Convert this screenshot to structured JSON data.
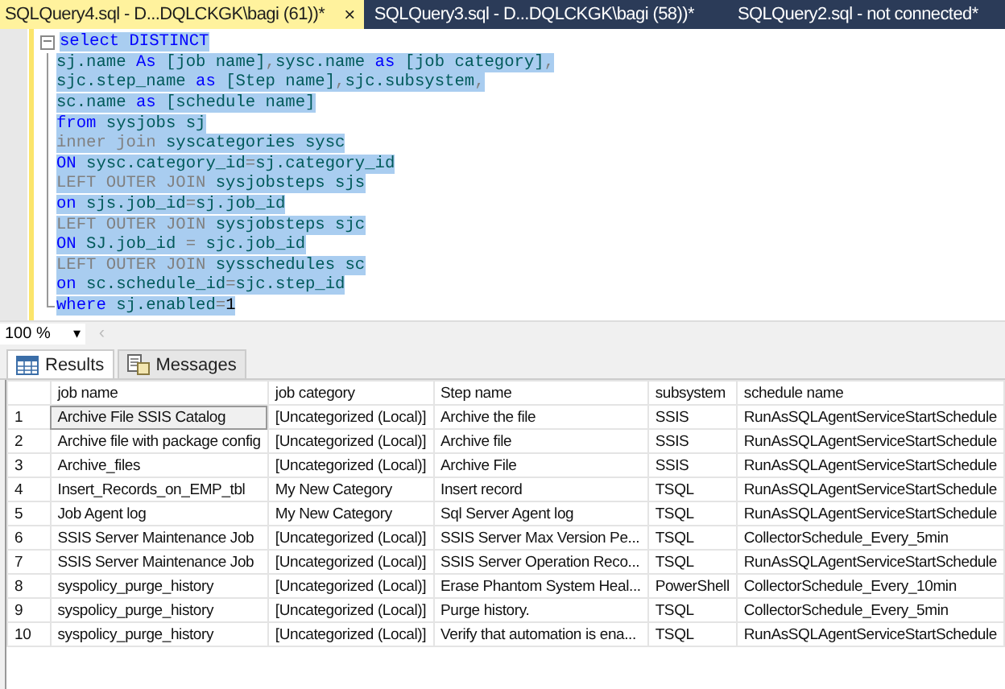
{
  "tabs": [
    {
      "label": "SQLQuery4.sql - D...DQLCKGK\\bagi (61))*",
      "selected": true,
      "close": "×"
    },
    {
      "label": "SQLQuery3.sql - D...DQLCKGK\\bagi (58))*",
      "selected": false
    },
    {
      "label": "SQLQuery2.sql - not connected*",
      "selected": false
    }
  ],
  "editor": {
    "collapse": "−",
    "lines": [
      [
        {
          "text": "select DISTINCT",
          "kind": "kw"
        }
      ],
      [
        {
          "text": "sj.name ",
          "kind": "id"
        },
        {
          "text": "As ",
          "kind": "kw"
        },
        {
          "text": "[job name]",
          "kind": "id"
        },
        {
          "text": ",",
          "kind": "op"
        },
        {
          "text": "sysc.name ",
          "kind": "id"
        },
        {
          "text": "as ",
          "kind": "kw"
        },
        {
          "text": "[job category]",
          "kind": "id"
        },
        {
          "text": ",",
          "kind": "op"
        }
      ],
      [
        {
          "text": "sjc.step_name ",
          "kind": "id"
        },
        {
          "text": "as ",
          "kind": "kw"
        },
        {
          "text": "[Step name]",
          "kind": "id"
        },
        {
          "text": ",",
          "kind": "op"
        },
        {
          "text": "sjc.subsystem",
          "kind": "id"
        },
        {
          "text": ",",
          "kind": "op"
        }
      ],
      [
        {
          "text": "sc.name ",
          "kind": "id"
        },
        {
          "text": "as ",
          "kind": "kw"
        },
        {
          "text": "[schedule name]",
          "kind": "id"
        }
      ],
      [
        {
          "text": "from ",
          "kind": "kw"
        },
        {
          "text": "sysjobs sj",
          "kind": "id"
        }
      ],
      [
        {
          "text": "inner join ",
          "kind": "op"
        },
        {
          "text": "syscategories sysc",
          "kind": "id"
        }
      ],
      [
        {
          "text": "ON ",
          "kind": "kw"
        },
        {
          "text": "sysc.category_id",
          "kind": "id"
        },
        {
          "text": "=",
          "kind": "op"
        },
        {
          "text": "sj.category_id",
          "kind": "id"
        }
      ],
      [
        {
          "text": "LEFT OUTER JOIN ",
          "kind": "op"
        },
        {
          "text": "sysjobsteps sjs",
          "kind": "id"
        }
      ],
      [
        {
          "text": "on ",
          "kind": "kw"
        },
        {
          "text": "sjs.job_id",
          "kind": "id"
        },
        {
          "text": "=",
          "kind": "op"
        },
        {
          "text": "sj.job_id",
          "kind": "id"
        }
      ],
      [
        {
          "text": "LEFT OUTER JOIN ",
          "kind": "op"
        },
        {
          "text": "sysjobsteps sjc",
          "kind": "id"
        }
      ],
      [
        {
          "text": "ON ",
          "kind": "kw"
        },
        {
          "text": "SJ.job_id ",
          "kind": "id"
        },
        {
          "text": "=",
          "kind": "op"
        },
        {
          "text": " sjc.job_id",
          "kind": "id"
        }
      ],
      [
        {
          "text": "LEFT OUTER JOIN ",
          "kind": "op"
        },
        {
          "text": "sysschedules sc",
          "kind": "id"
        }
      ],
      [
        {
          "text": "on ",
          "kind": "kw"
        },
        {
          "text": "sc.schedule_id",
          "kind": "id"
        },
        {
          "text": "=",
          "kind": "op"
        },
        {
          "text": "sjc.step_id",
          "kind": "id"
        }
      ],
      [
        {
          "text": "where ",
          "kind": "kw"
        },
        {
          "text": "sj.enabled",
          "kind": "id"
        },
        {
          "text": "=",
          "kind": "op"
        },
        {
          "text": "1",
          "kind": "num"
        }
      ]
    ]
  },
  "zoom": {
    "value": "100 %",
    "caret": "▾",
    "scroll": "‹"
  },
  "result_tabs": [
    {
      "label": "Results",
      "selected": true,
      "kind": "grid"
    },
    {
      "label": "Messages",
      "selected": false,
      "kind": "messages"
    }
  ],
  "table": {
    "columns": [
      "job name",
      "job category",
      "Step name",
      "subsystem",
      "schedule name"
    ],
    "rows": [
      {
        "number": "1",
        "focused": true,
        "cells": [
          "Archive File SSIS Catalog",
          "[Uncategorized (Local)]",
          "Archive the file",
          "SSIS",
          "RunAsSQLAgentServiceStartSchedule"
        ]
      },
      {
        "number": "2",
        "focused": false,
        "cells": [
          "Archive file with package config",
          "[Uncategorized (Local)]",
          "Archive file",
          "SSIS",
          "RunAsSQLAgentServiceStartSchedule"
        ]
      },
      {
        "number": "3",
        "focused": false,
        "cells": [
          "Archive_files",
          "[Uncategorized (Local)]",
          "Archive File",
          "SSIS",
          "RunAsSQLAgentServiceStartSchedule"
        ]
      },
      {
        "number": "4",
        "focused": false,
        "cells": [
          "Insert_Records_on_EMP_tbl",
          "My New Category",
          "Insert record",
          "TSQL",
          "RunAsSQLAgentServiceStartSchedule"
        ]
      },
      {
        "number": "5",
        "focused": false,
        "cells": [
          "Job Agent log",
          "My New Category",
          "Sql Server Agent log",
          "TSQL",
          "RunAsSQLAgentServiceStartSchedule"
        ]
      },
      {
        "number": "6",
        "focused": false,
        "cells": [
          "SSIS Server Maintenance Job",
          "[Uncategorized (Local)]",
          "SSIS Server Max Version Pe...",
          "TSQL",
          "CollectorSchedule_Every_5min"
        ]
      },
      {
        "number": "7",
        "focused": false,
        "cells": [
          "SSIS Server Maintenance Job",
          "[Uncategorized (Local)]",
          "SSIS Server Operation Reco...",
          "TSQL",
          "RunAsSQLAgentServiceStartSchedule"
        ]
      },
      {
        "number": "8",
        "focused": false,
        "cells": [
          "syspolicy_purge_history",
          "[Uncategorized (Local)]",
          "Erase Phantom System Heal...",
          "PowerShell",
          "CollectorSchedule_Every_10min"
        ]
      },
      {
        "number": "9",
        "focused": false,
        "cells": [
          "syspolicy_purge_history",
          "[Uncategorized (Local)]",
          "Purge history.",
          "TSQL",
          "CollectorSchedule_Every_5min"
        ]
      },
      {
        "number": "10",
        "focused": false,
        "cells": [
          "syspolicy_purge_history",
          "[Uncategorized (Local)]",
          "Verify that automation is ena...",
          "TSQL",
          "RunAsSQLAgentServiceStartSchedule"
        ]
      }
    ]
  }
}
